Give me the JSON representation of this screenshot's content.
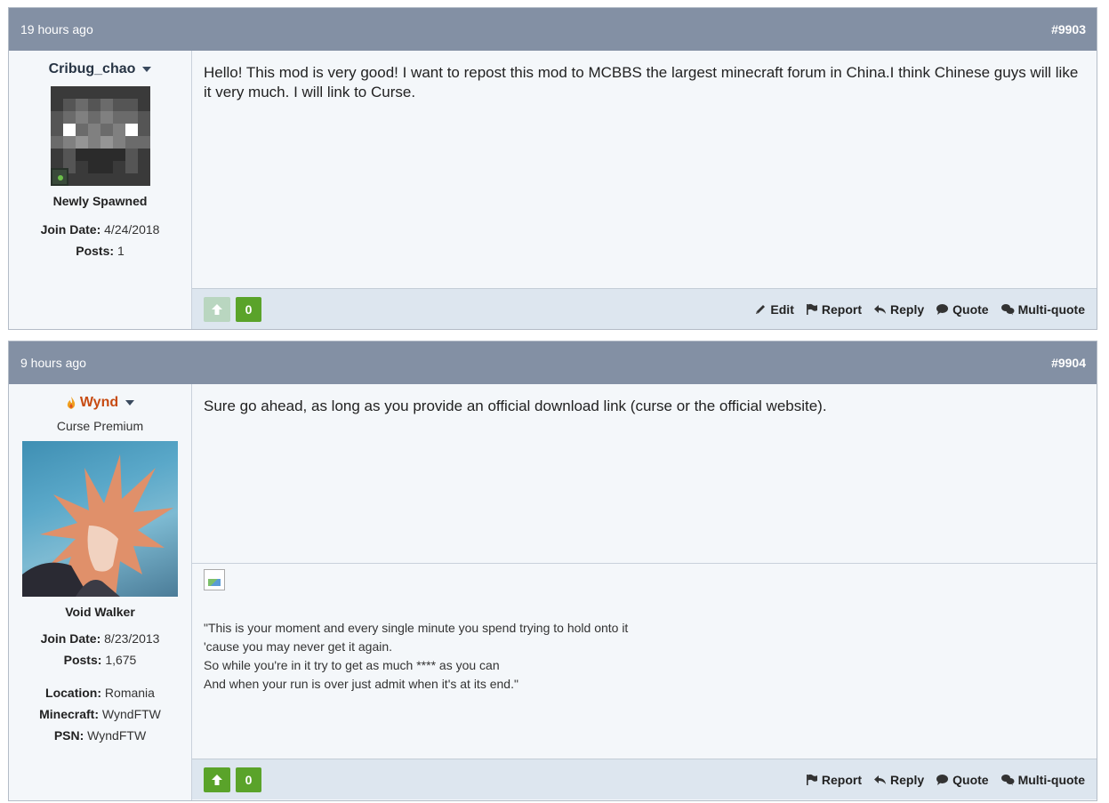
{
  "posts": [
    {
      "time": "19 hours ago",
      "number": "#9903",
      "author": {
        "name": "Cribug_chao",
        "title": "",
        "rank": "Newly Spawned",
        "online": true
      },
      "stats": [
        {
          "label": "Join Date:",
          "value": "4/24/2018"
        },
        {
          "label": "Posts:",
          "value": "1"
        }
      ],
      "message": "Hello! This mod is very good! I want to repost this mod to MCBBS the largest minecraft forum in China.I think Chinese guys will like it very much. I will link to Curse.",
      "score": "0",
      "upvote_enabled": false,
      "actions": [
        "Edit",
        "Report",
        "Reply",
        "Quote",
        "Multi-quote"
      ]
    },
    {
      "time": "9 hours ago",
      "number": "#9904",
      "author": {
        "name": "Wynd",
        "title": "Curse Premium",
        "rank": "Void Walker",
        "online": false
      },
      "stats": [
        {
          "label": "Join Date:",
          "value": "8/23/2013"
        },
        {
          "label": "Posts:",
          "value": "1,675"
        }
      ],
      "profile": [
        {
          "label": "Location:",
          "value": "Romania"
        },
        {
          "label": "Minecraft:",
          "value": "WyndFTW"
        },
        {
          "label": "PSN:",
          "value": "WyndFTW"
        }
      ],
      "message": "Sure go ahead, as long as you provide an official download link (curse or the official website).",
      "signature": [
        "\"This is your moment and every single minute you spend trying to hold onto it",
        "'cause you may never get it again.",
        "So while you're in it try to get as much **** as you can",
        "And when your run is over just admit when it's at its end.\""
      ],
      "score": "0",
      "upvote_enabled": true,
      "actions": [
        "Report",
        "Reply",
        "Quote",
        "Multi-quote"
      ]
    }
  ],
  "colors": {
    "header": "#8390a4",
    "body": "#f4f7fa",
    "footer": "#dde6ef",
    "vote_green": "#5aa32a",
    "premium_name": "#c74b12"
  }
}
